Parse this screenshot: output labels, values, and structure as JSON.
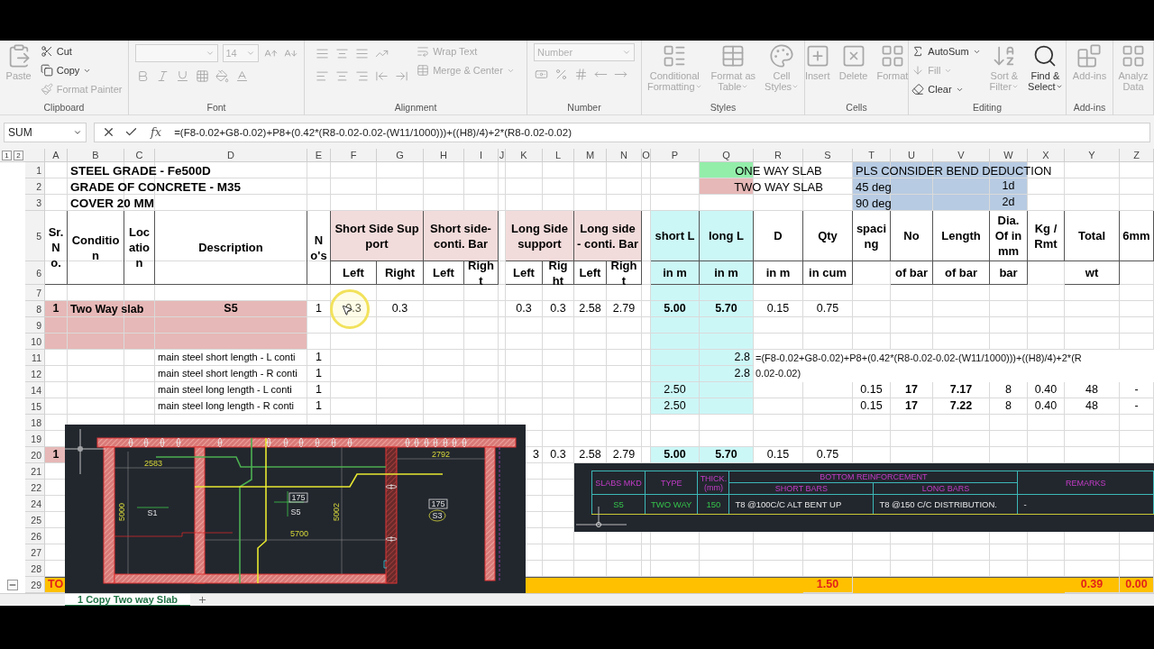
{
  "ribbon": {
    "groups": [
      {
        "label": "Clipboard",
        "columns": [
          [
            {
              "kind": "large",
              "text": "Paste",
              "disabled": true
            }
          ],
          [
            {
              "kind": "small",
              "text": "Cut",
              "disabled": false
            },
            {
              "kind": "small",
              "text": "Copy",
              "disabled": false,
              "menu": true
            },
            {
              "kind": "small",
              "text": "Format Painter",
              "disabled": true
            }
          ]
        ]
      },
      {
        "label": "Font",
        "columns": [
          [
            {
              "kind": "combo-pair",
              "value": "14",
              "disabled": true
            },
            {
              "kind": "tools",
              "disabled": true
            }
          ]
        ]
      },
      {
        "label": "Alignment",
        "columns": [
          [
            {
              "kind": "tools",
              "disabled": true
            },
            {
              "kind": "tools",
              "disabled": true
            }
          ],
          [
            {
              "kind": "small",
              "text": "Wrap Text",
              "disabled": true
            },
            {
              "kind": "small",
              "text": "Merge & Center",
              "disabled": true,
              "menu": true
            }
          ]
        ]
      },
      {
        "label": "Number",
        "columns": [
          [
            {
              "kind": "combo",
              "value": "Number",
              "disabled": true
            },
            {
              "kind": "tools",
              "disabled": true
            }
          ]
        ]
      },
      {
        "label": "Styles",
        "columns": [
          [
            {
              "kind": "large",
              "text": "Conditional\nFormatting",
              "disabled": true,
              "menu": true
            }
          ],
          [
            {
              "kind": "large",
              "text": "Format as\nTable",
              "disabled": true,
              "menu": true
            }
          ],
          [
            {
              "kind": "large",
              "text": "Cell\nStyles",
              "disabled": true,
              "menu": true
            }
          ]
        ]
      },
      {
        "label": "Cells",
        "columns": [
          [
            {
              "kind": "large",
              "text": "Insert",
              "disabled": true
            }
          ],
          [
            {
              "kind": "large",
              "text": "Delete",
              "disabled": true
            }
          ],
          [
            {
              "kind": "large",
              "text": "Format",
              "disabled": true
            }
          ]
        ]
      },
      {
        "label": "Editing",
        "columns": [
          [
            {
              "kind": "small",
              "text": "AutoSum",
              "disabled": false,
              "menu": true
            },
            {
              "kind": "small",
              "text": "Fill",
              "disabled": true,
              "menu": true
            },
            {
              "kind": "small",
              "text": "Clear",
              "disabled": false,
              "menu": true
            }
          ],
          [
            {
              "kind": "large",
              "text": "Sort &\nFilter",
              "disabled": true,
              "menu": true
            }
          ],
          [
            {
              "kind": "large",
              "text": "Find &\nSelect",
              "disabled": false,
              "menu": true
            }
          ]
        ]
      },
      {
        "label": "Add-ins",
        "columns": [
          [
            {
              "kind": "large",
              "text": "Add-ins",
              "disabled": true
            }
          ]
        ]
      },
      {
        "columns": [
          [
            {
              "kind": "large",
              "text": "Analyz\nData",
              "disabled": true
            }
          ]
        ]
      }
    ]
  },
  "formula_bar": {
    "name_box": "SUM",
    "fx": "fx",
    "formula": "=(F8-0.02+G8-0.02)+P8+(0.42*(R8-0.02-0.02-(W11/1000)))+((H8)/4)+2*(R8-0.02-0.02)"
  },
  "sheet": {
    "outline_levels": [
      "1",
      "2"
    ],
    "columns": [
      "A",
      "B",
      "C",
      "D",
      "E",
      "F",
      "G",
      "H",
      "I",
      "J",
      "K",
      "L",
      "M",
      "N",
      "O",
      "P",
      "Q",
      "R",
      "S",
      "T",
      "U",
      "V",
      "W",
      "X",
      "Y",
      "Z"
    ],
    "rows": [
      {
        "number": "1",
        "kind": "normal",
        "cells": [
          "",
          {
            "kind": "title",
            "text": "STEEL GRADE - Fe500D"
          },
          "",
          "",
          "",
          "",
          "",
          "",
          "",
          "",
          "",
          "",
          "",
          "",
          "",
          "",
          {
            "color": "#93eeaa"
          },
          {
            "kind": "note",
            "text": "ONE WAY SLAB"
          },
          "",
          {
            "kind": "note-left",
            "text": "PLS CONSIDER BEND DEDUCTION",
            "color": "#b7cbe2"
          },
          {
            "color": "#b7cbe2"
          },
          {
            "color": "#b7cbe2"
          },
          {
            "color": "#b7cbe2"
          }
        ]
      },
      {
        "number": "2",
        "kind": "normal",
        "cells": [
          "",
          {
            "kind": "title",
            "text": "GRADE OF CONCRETE - M35"
          },
          "",
          "",
          "",
          "",
          "",
          "",
          "",
          "",
          "",
          "",
          "",
          "",
          "",
          "",
          {
            "color": "#e6b8b7"
          },
          {
            "kind": "note",
            "text": "TWO WAY SLAB"
          },
          "",
          {
            "kind": "note-left",
            "text": "45 deg",
            "color": "#b7cbe2"
          },
          {
            "color": "#b7cbe2"
          },
          {
            "color": "#b7cbe2"
          },
          {
            "text": "1d",
            "color": "#b7cbe2"
          }
        ]
      },
      {
        "number": "3",
        "kind": "normal",
        "cells": [
          "",
          {
            "kind": "title",
            "text": "COVER 20 MM"
          },
          "",
          "",
          "",
          "",
          "",
          "",
          "",
          "",
          "",
          "",
          "",
          "",
          "",
          "",
          "",
          "",
          "",
          {
            "kind": "note-left",
            "text": "90 deg",
            "color": "#b7cbe2"
          },
          {
            "color": "#b7cbe2"
          },
          {
            "color": "#b7cbe2"
          },
          {
            "text": "2d",
            "color": "#b7cbe2"
          }
        ]
      },
      {
        "number": "5",
        "kind": "tall",
        "cells": [
          {
            "kind": "head",
            "text": "Sr. No.",
            "merge_down": true
          },
          {
            "kind": "head",
            "text": "Condition",
            "merge_down": true
          },
          {
            "kind": "head",
            "text": "Location",
            "merge_down": true
          },
          {
            "kind": "head",
            "text": "Description",
            "merge_down": true
          },
          {
            "kind": "head",
            "text": "No's",
            "merge_down": true
          },
          {
            "kind": "head",
            "text": "Short Side Support",
            "wide": true,
            "color": "#f2dcdb"
          },
          "",
          {
            "kind": "head",
            "text": "Short side- conti. Bar",
            "wide": true,
            "color": "#f2dcdb"
          },
          "",
          "",
          {
            "kind": "head",
            "text": "Long Side support",
            "wide": true,
            "color": "#f2dcdb"
          },
          "",
          {
            "kind": "head",
            "text": "Long side - conti. Bar",
            "wide": true,
            "color": "#f2dcdb"
          },
          "",
          "",
          {
            "kind": "head",
            "text": "short L",
            "color": "#ccf7f7"
          },
          {
            "kind": "head",
            "text": "long L",
            "color": "#ccf7f7"
          },
          {
            "kind": "head",
            "text": "D"
          },
          {
            "kind": "head",
            "text": "Qty"
          },
          {
            "kind": "head",
            "text": "spacing"
          },
          {
            "kind": "head",
            "text": "No"
          },
          {
            "kind": "head",
            "text": "Length"
          },
          {
            "kind": "head",
            "text": "Dia. Of in mm"
          },
          {
            "kind": "head",
            "text": "Kg / Rmt"
          },
          {
            "kind": "head",
            "text": "Total"
          },
          {
            "kind": "head",
            "text": "6mm"
          }
        ]
      },
      {
        "number": "6",
        "kind": "sub",
        "cells": [
          "",
          "",
          "",
          "",
          "",
          {
            "kind": "head",
            "text": "Left"
          },
          {
            "kind": "head",
            "text": "Right"
          },
          {
            "kind": "head",
            "text": "Left"
          },
          {
            "kind": "head",
            "text": "Right"
          },
          "",
          {
            "kind": "head",
            "text": "Left"
          },
          {
            "kind": "head",
            "text": "Right"
          },
          {
            "kind": "head",
            "text": "Left"
          },
          {
            "kind": "head",
            "text": "Right"
          },
          "",
          {
            "kind": "head",
            "text": "in m",
            "color": "#ccf7f7"
          },
          {
            "kind": "head",
            "text": "in m",
            "color": "#ccf7f7"
          },
          {
            "kind": "head",
            "text": "in m"
          },
          {
            "kind": "head",
            "text": "in cum"
          },
          "",
          {
            "kind": "head",
            "text": "of bar"
          },
          {
            "kind": "head",
            "text": "of bar"
          },
          {
            "kind": "head",
            "text": "bar"
          },
          "",
          {
            "kind": "head",
            "text": "wt"
          }
        ]
      },
      {
        "number": "7",
        "kind": "normal",
        "cells": [
          "",
          "",
          "",
          "",
          "",
          "",
          "",
          "",
          "",
          "",
          "",
          "",
          "",
          "",
          "",
          {
            "color": "#ccf7f7"
          },
          {
            "color": "#ccf7f7"
          }
        ]
      },
      {
        "number": "8",
        "kind": "normal",
        "cells": [
          {
            "kind": "strong",
            "text": "1",
            "color": "#e6b8b7"
          },
          {
            "kind": "strong-left",
            "text": "Two Way slab",
            "color": "#e6b8b7"
          },
          {
            "color": "#e6b8b7"
          },
          {
            "kind": "strong",
            "text": "S5",
            "color": "#e6b8b7"
          },
          "1",
          "0.3",
          "0.3",
          "",
          "",
          "",
          "0.3",
          "0.3",
          "2.58",
          "2.79",
          "",
          {
            "kind": "strong",
            "text": "5.00",
            "color": "#ccf7f7"
          },
          {
            "kind": "strong",
            "text": "5.70",
            "color": "#ccf7f7"
          },
          "0.15",
          "0.75"
        ]
      },
      {
        "number": "9",
        "kind": "normal",
        "cells": [
          {
            "color": "#e6b8b7"
          },
          {
            "color": "#e6b8b7"
          },
          {
            "color": "#e6b8b7"
          },
          {
            "color": "#e6b8b7"
          },
          "",
          "",
          "",
          "",
          "",
          "",
          "",
          "",
          "",
          "",
          "",
          {
            "color": "#ccf7f7"
          },
          {
            "color": "#ccf7f7"
          }
        ]
      },
      {
        "number": "10",
        "kind": "normal",
        "cells": [
          {
            "color": "#e6b8b7"
          },
          {
            "color": "#e6b8b7"
          },
          {
            "color": "#e6b8b7"
          },
          {
            "color": "#e6b8b7"
          },
          "",
          "",
          "",
          "",
          "",
          "",
          "",
          "",
          "",
          "",
          "",
          {
            "color": "#ccf7f7"
          },
          {
            "color": "#ccf7f7"
          }
        ]
      },
      {
        "number": "11",
        "kind": "normal",
        "cells": [
          "",
          "",
          "",
          {
            "kind": "label",
            "text": "main steel short length - L conti"
          },
          "1",
          "",
          "",
          "",
          "",
          "",
          "",
          "",
          "",
          "",
          "",
          {
            "color": "#ccf7f7"
          },
          {
            "kind": "value-right",
            "text": "2.8",
            "color": "#ccf7f7"
          }
        ]
      },
      {
        "number": "12",
        "kind": "normal",
        "cells": [
          "",
          "",
          "",
          {
            "kind": "label",
            "text": "main steel short length - R conti"
          },
          "1",
          "",
          "",
          "",
          "",
          "",
          "",
          "",
          "",
          "",
          "",
          {
            "color": "#ccf7f7"
          },
          {
            "kind": "value-right",
            "text": "2.8",
            "color": "#ccf7f7"
          }
        ]
      },
      {
        "number": "14",
        "kind": "normal",
        "cells": [
          "",
          "",
          "",
          {
            "kind": "label",
            "text": "main steel long length - L conti"
          },
          "1",
          "",
          "",
          "",
          "",
          "",
          "",
          "",
          "",
          "",
          "",
          {
            "text": "2.50",
            "color": "#ccf7f7"
          },
          {
            "color": "#ccf7f7"
          },
          "",
          "",
          "0.15",
          {
            "kind": "strong",
            "text": "17"
          },
          {
            "kind": "strong",
            "text": "7.17"
          },
          "8",
          "0.40",
          "48",
          "-"
        ]
      },
      {
        "number": "15",
        "kind": "normal",
        "cells": [
          "",
          "",
          "",
          {
            "kind": "label",
            "text": "main steel long length - R conti"
          },
          "1",
          "",
          "",
          "",
          "",
          "",
          "",
          "",
          "",
          "",
          "",
          {
            "text": "2.50",
            "color": "#ccf7f7"
          },
          {
            "color": "#ccf7f7"
          },
          "",
          "",
          "0.15",
          {
            "kind": "strong",
            "text": "17"
          },
          {
            "kind": "strong",
            "text": "7.22"
          },
          "8",
          "0.40",
          "48",
          "-"
        ]
      },
      {
        "number": "18",
        "kind": "normal",
        "cells": []
      },
      {
        "number": "19",
        "kind": "normal",
        "cells": []
      },
      {
        "number": "20",
        "kind": "normal",
        "cells": [
          {
            "kind": "strong",
            "text": "1",
            "color": "#e6b8b7"
          },
          "",
          "",
          "",
          "",
          "",
          "",
          "",
          "",
          "",
          {
            "kind": "value-right",
            "text": "3"
          },
          "0.3",
          "2.58",
          "2.79",
          "",
          {
            "kind": "strong",
            "text": "5.00",
            "color": "#ccf7f7"
          },
          {
            "kind": "strong",
            "text": "5.70",
            "color": "#ccf7f7"
          },
          "0.15",
          "0.75"
        ]
      },
      {
        "number": "21",
        "kind": "normal",
        "cells": []
      },
      {
        "number": "22",
        "kind": "normal",
        "cells": []
      },
      {
        "number": "24",
        "kind": "normal",
        "cells": []
      },
      {
        "number": "25",
        "kind": "normal",
        "cells": []
      },
      {
        "number": "26",
        "kind": "normal",
        "cells": []
      },
      {
        "number": "27",
        "kind": "normal",
        "cells": []
      },
      {
        "number": "28",
        "kind": "normal",
        "cells": []
      },
      {
        "number": "29",
        "kind": "total",
        "outline_button": true,
        "cells": [
          {
            "kind": "total-left",
            "text": "TO"
          },
          "",
          "",
          "",
          "",
          "",
          "",
          "",
          "",
          "",
          "",
          "",
          "",
          "",
          "",
          "",
          "",
          "",
          {
            "kind": "total",
            "text": "1.50"
          },
          "",
          "",
          "",
          "",
          "",
          {
            "kind": "total",
            "text": "0.39"
          },
          {
            "kind": "total",
            "text": "0.00"
          }
        ]
      }
    ]
  },
  "cell_editor": {
    "lines": [
      "=(F8-0.02+G8-0.02)+P8+(0.42*(R8-0.02-0.02-(W11/1000)))+((H8)/4)+2*(R",
      "0.02-0.02)"
    ]
  },
  "cad_plan": {
    "labels": [
      {
        "kind": "dimension",
        "text": "2792"
      },
      {
        "kind": "dimension",
        "text": "2583"
      },
      {
        "kind": "tag",
        "text": "175"
      },
      {
        "kind": "tag",
        "text": "175"
      },
      {
        "kind": "dimension-vertical",
        "text": "5000"
      },
      {
        "kind": "slab",
        "text": "S1"
      },
      {
        "kind": "slab",
        "text": "S5"
      },
      {
        "kind": "dimension-vertical",
        "text": "5002"
      },
      {
        "kind": "slab-circled",
        "text": "S3"
      },
      {
        "kind": "dimension",
        "text": "5700"
      }
    ]
  },
  "cad_table": {
    "headers": [
      "SLABS MKD",
      "TYPE",
      "THICK. (mm)",
      "BOTTOM REINFORCEMENT",
      "REMARKS"
    ],
    "subheaders": [
      "SHORT BARS",
      "LONG BARS"
    ],
    "row": [
      {
        "kind": "id",
        "text": "S5"
      },
      {
        "kind": "id",
        "text": "TWO WAY"
      },
      {
        "kind": "id",
        "text": "150"
      },
      {
        "kind": "text",
        "text": "T8 @100C/C ALT BENT UP"
      },
      {
        "kind": "text",
        "text": "T8 @150 C/C DISTRIBUTION."
      },
      {
        "kind": "text",
        "text": "-"
      }
    ]
  },
  "sheet_tabs": [
    {
      "label": "1 Copy Two way Slab",
      "selected": true
    }
  ]
}
